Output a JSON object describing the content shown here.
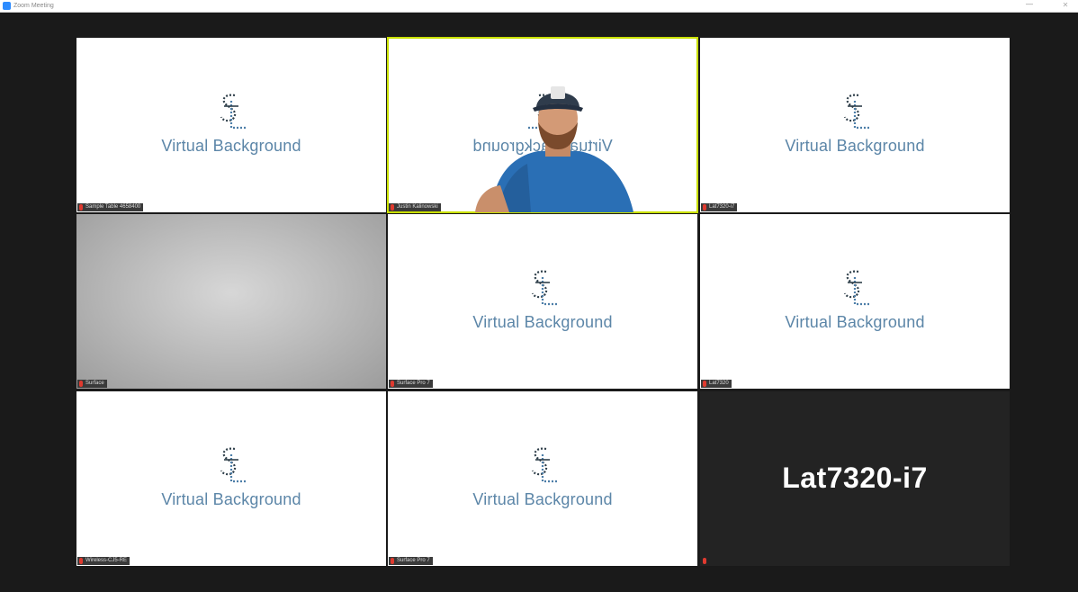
{
  "window": {
    "title": "Zoom Meeting",
    "minimize": "—",
    "close": "✕"
  },
  "tiles": [
    {
      "name": "Sample Table 4658400",
      "background_text": "Virtual Background",
      "type": "virtual-bg",
      "muted": true
    },
    {
      "name": "Justin Kalinowski",
      "background_text": "Virtual Background",
      "type": "video",
      "muted": true,
      "active_speaker": true
    },
    {
      "name": "Lat7320-i7",
      "background_text": "Virtual Background",
      "type": "virtual-bg",
      "muted": true
    },
    {
      "name": "Surface",
      "background_text": "",
      "type": "blank-video",
      "muted": true
    },
    {
      "name": "Surface Pro 7",
      "background_text": "Virtual Background",
      "type": "virtual-bg",
      "muted": true
    },
    {
      "name": "Lat7320",
      "background_text": "Virtual Background",
      "type": "virtual-bg",
      "muted": true
    },
    {
      "name": "Wireless-CJ5-RE",
      "background_text": "Virtual Background",
      "type": "virtual-bg",
      "muted": true
    },
    {
      "name": "Surface Pro 7",
      "background_text": "Virtual Background",
      "type": "virtual-bg",
      "muted": true
    },
    {
      "name": "Lat7320-i7",
      "background_text": "",
      "type": "video-off",
      "muted": true
    }
  ],
  "colors": {
    "active_speaker_border": "#c9e000",
    "mic_muted": "#e03a2f",
    "logo_blue": "#5c86a8"
  },
  "icons": {
    "app": "zoom-icon",
    "mic": "mic-muted-icon",
    "logo": "sl-logo-icon"
  }
}
